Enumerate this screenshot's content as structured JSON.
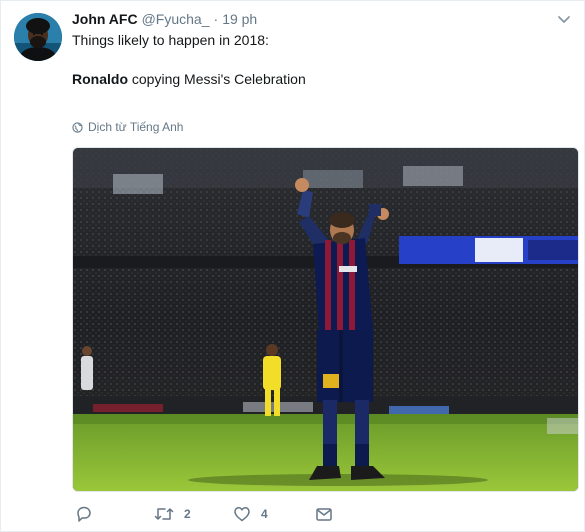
{
  "tweet": {
    "display_name": "John AFC",
    "handle": "@Fyucha_",
    "separator": "·",
    "time": "19 ph",
    "text_line1": "Things likely to happen in 2018:",
    "text_line2_bold": "Ronaldo",
    "text_line2_rest": " copying Messi's Celebration",
    "translate_label": "Dịch từ Tiếng Anh"
  },
  "actions": {
    "reply_icon": "reply-icon",
    "retweet_icon": "retweet-icon",
    "retweet_count": "2",
    "like_icon": "heart-icon",
    "like_count": "4",
    "dm_icon": "envelope-icon"
  },
  "colors": {
    "text": "#14171a",
    "secondary": "#657786",
    "border": "#e6ecf0"
  }
}
